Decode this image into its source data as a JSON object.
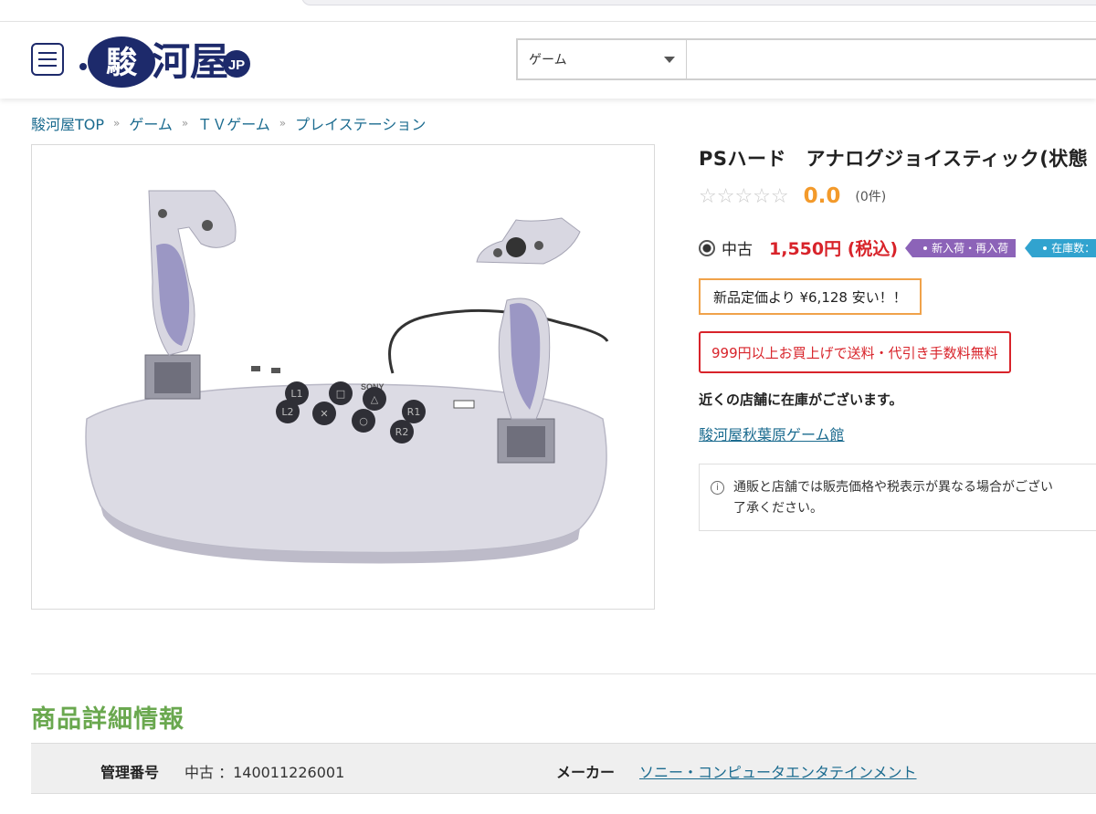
{
  "header": {
    "logo_text": "駿河屋",
    "logo_badge": "JP",
    "search_category": "ゲーム"
  },
  "breadcrumb": [
    "駿河屋TOP",
    "ゲーム",
    "ＴＶゲーム",
    "プレイステーション"
  ],
  "product": {
    "title": "PSハード　アナログジョイスティック(状態",
    "rating_stars": "☆☆☆☆☆",
    "rating_score": "0.0",
    "rating_count": "(0件)",
    "condition": "中古",
    "price": "1,550円 (税込)",
    "tag_new": "新入荷・再入荷",
    "tag_stock": "在庫数：",
    "savings": "新品定価より ¥6,128 安い！！",
    "shipping": "999円以上お買上げで送料・代引き手数料無料",
    "stock_message": "近くの店舗に在庫がございます。",
    "store_name": "駿河屋秋葉原ゲーム館",
    "notice_line1": "通販と店舗では販売価格や税表示が異なる場合がござい",
    "notice_line2": "了承ください。",
    "image_brand": "SONY",
    "image_buttons": [
      "L1",
      "□",
      "△",
      "R1",
      "L2",
      "✕",
      "○",
      "R2"
    ]
  },
  "details": {
    "section_title": "商品詳細情報",
    "mgmt_label": "管理番号",
    "mgmt_value": "中古 ：140011226001",
    "maker_label": "メーカー",
    "maker_value": "ソニー・コンピュータエンタテインメント"
  },
  "colors": {
    "brand_navy": "#1d2a6b",
    "link": "#1b6b8f",
    "price_red": "#d8232a",
    "score_orange": "#f39a2b",
    "section_green": "#6aa84f",
    "tag_purple": "#8c63b8",
    "tag_blue": "#31a3cf"
  }
}
